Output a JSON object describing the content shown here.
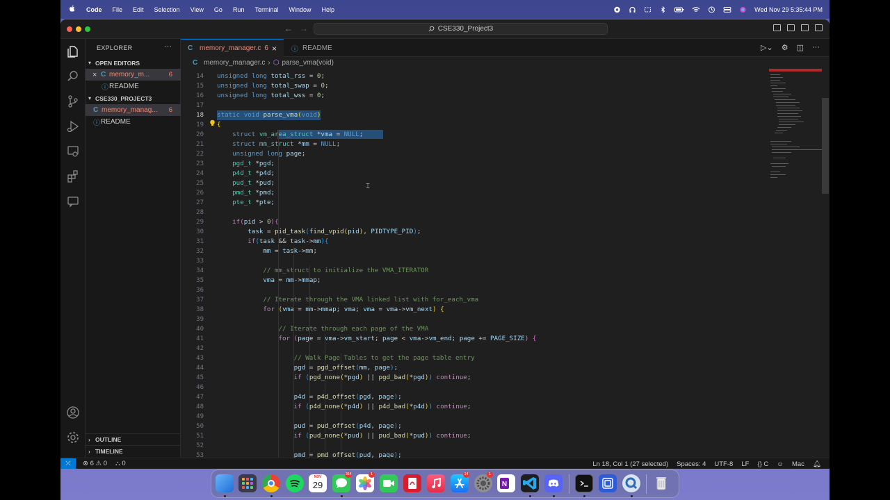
{
  "menubar": {
    "apple": "",
    "items": [
      "Code",
      "File",
      "Edit",
      "Selection",
      "View",
      "Go",
      "Run",
      "Terminal",
      "Window",
      "Help"
    ],
    "datetime": "Wed Nov 29  5:35:44 PM"
  },
  "titlebar": {
    "search_text": "CSE330_Project3"
  },
  "sidebar": {
    "title": "EXPLORER",
    "more": "···",
    "open_editors_label": "OPEN EDITORS",
    "open_editors": [
      {
        "name": "memory_m...",
        "badge": "6",
        "icon": "C"
      },
      {
        "name": "README",
        "icon": "ⓘ"
      }
    ],
    "project_label": "CSE330_PROJECT3",
    "files": [
      {
        "name": "memory_manag...",
        "badge": "6",
        "icon": "C"
      },
      {
        "name": "README",
        "icon": "ⓘ"
      }
    ],
    "outline_label": "OUTLINE",
    "timeline_label": "TIMELINE"
  },
  "tabs": [
    {
      "icon": "C",
      "label": "memory_manager.c",
      "badge": "6",
      "close": "×"
    },
    {
      "icon": "ⓘ",
      "label": "README"
    }
  ],
  "breadcrumb": {
    "file_icon": "C",
    "file": "memory_manager.c",
    "sep": "›",
    "symbol_icon": "⬡",
    "symbol": "parse_vma(void)"
  },
  "editor": {
    "line_numbers": [
      "14",
      "15",
      "16",
      "17",
      "18",
      "19",
      "20",
      "21",
      "22",
      "23",
      "24",
      "25",
      "26",
      "27",
      "28",
      "29",
      "30",
      "31",
      "32",
      "33",
      "34",
      "35",
      "36",
      "37",
      "38",
      "39",
      "40",
      "41",
      "42",
      "43",
      "44",
      "45",
      "46",
      "47",
      "48",
      "49",
      "50",
      "51",
      "52",
      "53"
    ],
    "current_line": "18"
  },
  "status": {
    "remote": "⤫",
    "errors": "6",
    "warnings": "0",
    "ports": "0",
    "position": "Ln 18, Col 1 (27 selected)",
    "spaces": "Spaces: 4",
    "encoding": "UTF-8",
    "eol": "LF",
    "language": "C",
    "language_braces": "{}",
    "platform": "Mac"
  },
  "dock": {
    "calendar_month": "NOV",
    "calendar_day": "29",
    "badges": {
      "messages": "364",
      "photos": "1",
      "appstore": "14",
      "settings": "1"
    }
  },
  "colors": {
    "accent": "#0078d4",
    "error_file": "#f48771",
    "editor_bg": "#1f1f1f"
  }
}
